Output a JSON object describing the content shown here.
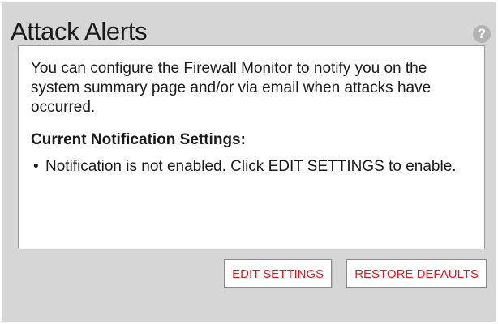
{
  "panel": {
    "title": "Attack Alerts",
    "help_icon": "?"
  },
  "content": {
    "intro": "You can configure the Firewall Monitor to notify you on the system summary page and/or via email when attacks have occurred.",
    "settings_heading": "Current Notification Settings:",
    "settings_items": [
      "Notification is not enabled. Click EDIT SETTINGS to enable."
    ]
  },
  "actions": {
    "edit_settings_label": "EDIT SETTINGS",
    "restore_defaults_label": "RESTORE DEFAULTS"
  },
  "colors": {
    "panel_background": "#d6d6d6",
    "button_text": "#e4141b",
    "help_icon": "#b3b3b3"
  }
}
